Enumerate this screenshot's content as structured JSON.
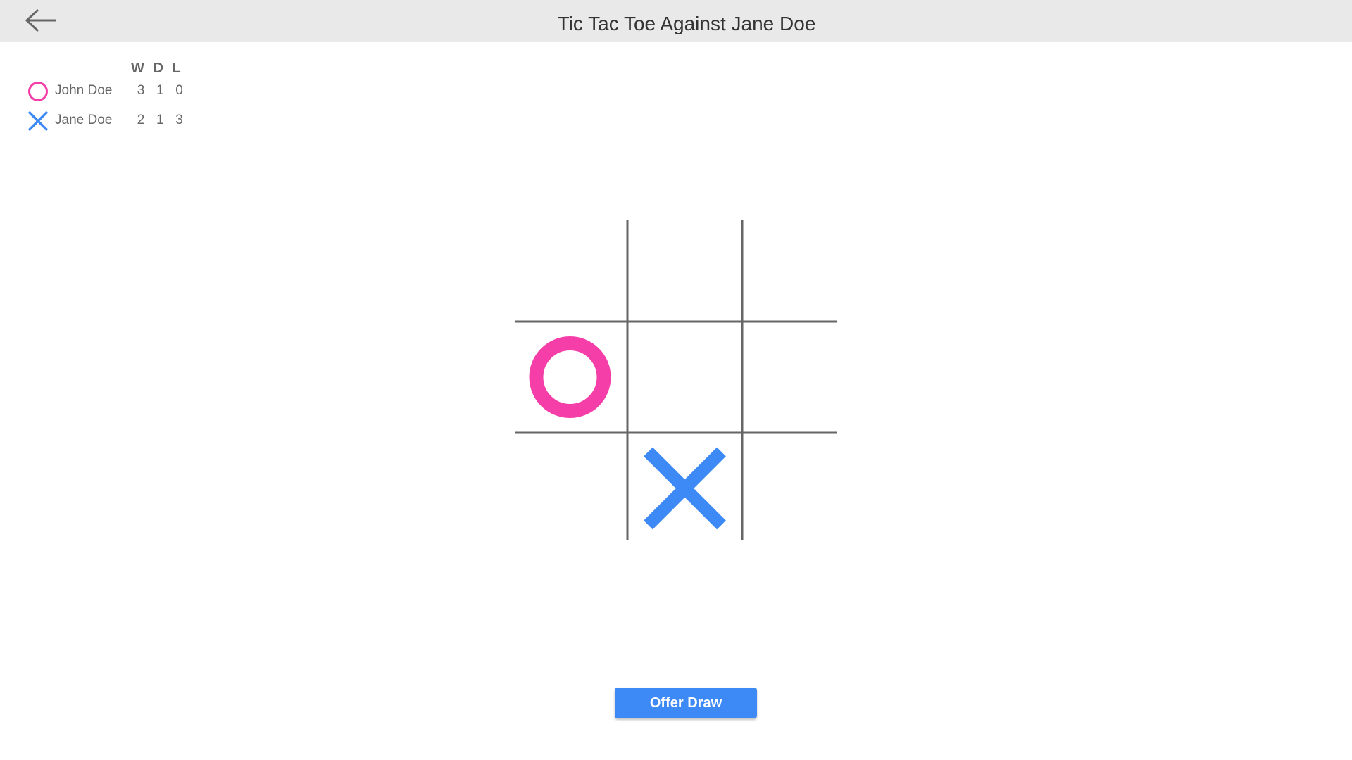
{
  "header": {
    "title": "Tic Tac Toe Against Jane Doe",
    "back_icon": "arrow-left-icon"
  },
  "scoreboard": {
    "columns": [
      "W",
      "D",
      "L"
    ],
    "players": [
      {
        "name": "John Doe",
        "mark": "O",
        "icon": "circle-icon",
        "color": "#f53ea7",
        "stats": [
          "3",
          "1",
          "0"
        ]
      },
      {
        "name": "Jane Doe",
        "mark": "X",
        "icon": "cross-icon",
        "color": "#3d8af7",
        "stats": [
          "2",
          "1",
          "3"
        ]
      }
    ]
  },
  "board": {
    "cells": [
      "",
      "",
      "",
      "O",
      "",
      "",
      "",
      "X",
      ""
    ],
    "line_color": "#666666"
  },
  "actions": {
    "offer_draw_label": "Offer Draw",
    "button_color": "#3d8af7"
  }
}
